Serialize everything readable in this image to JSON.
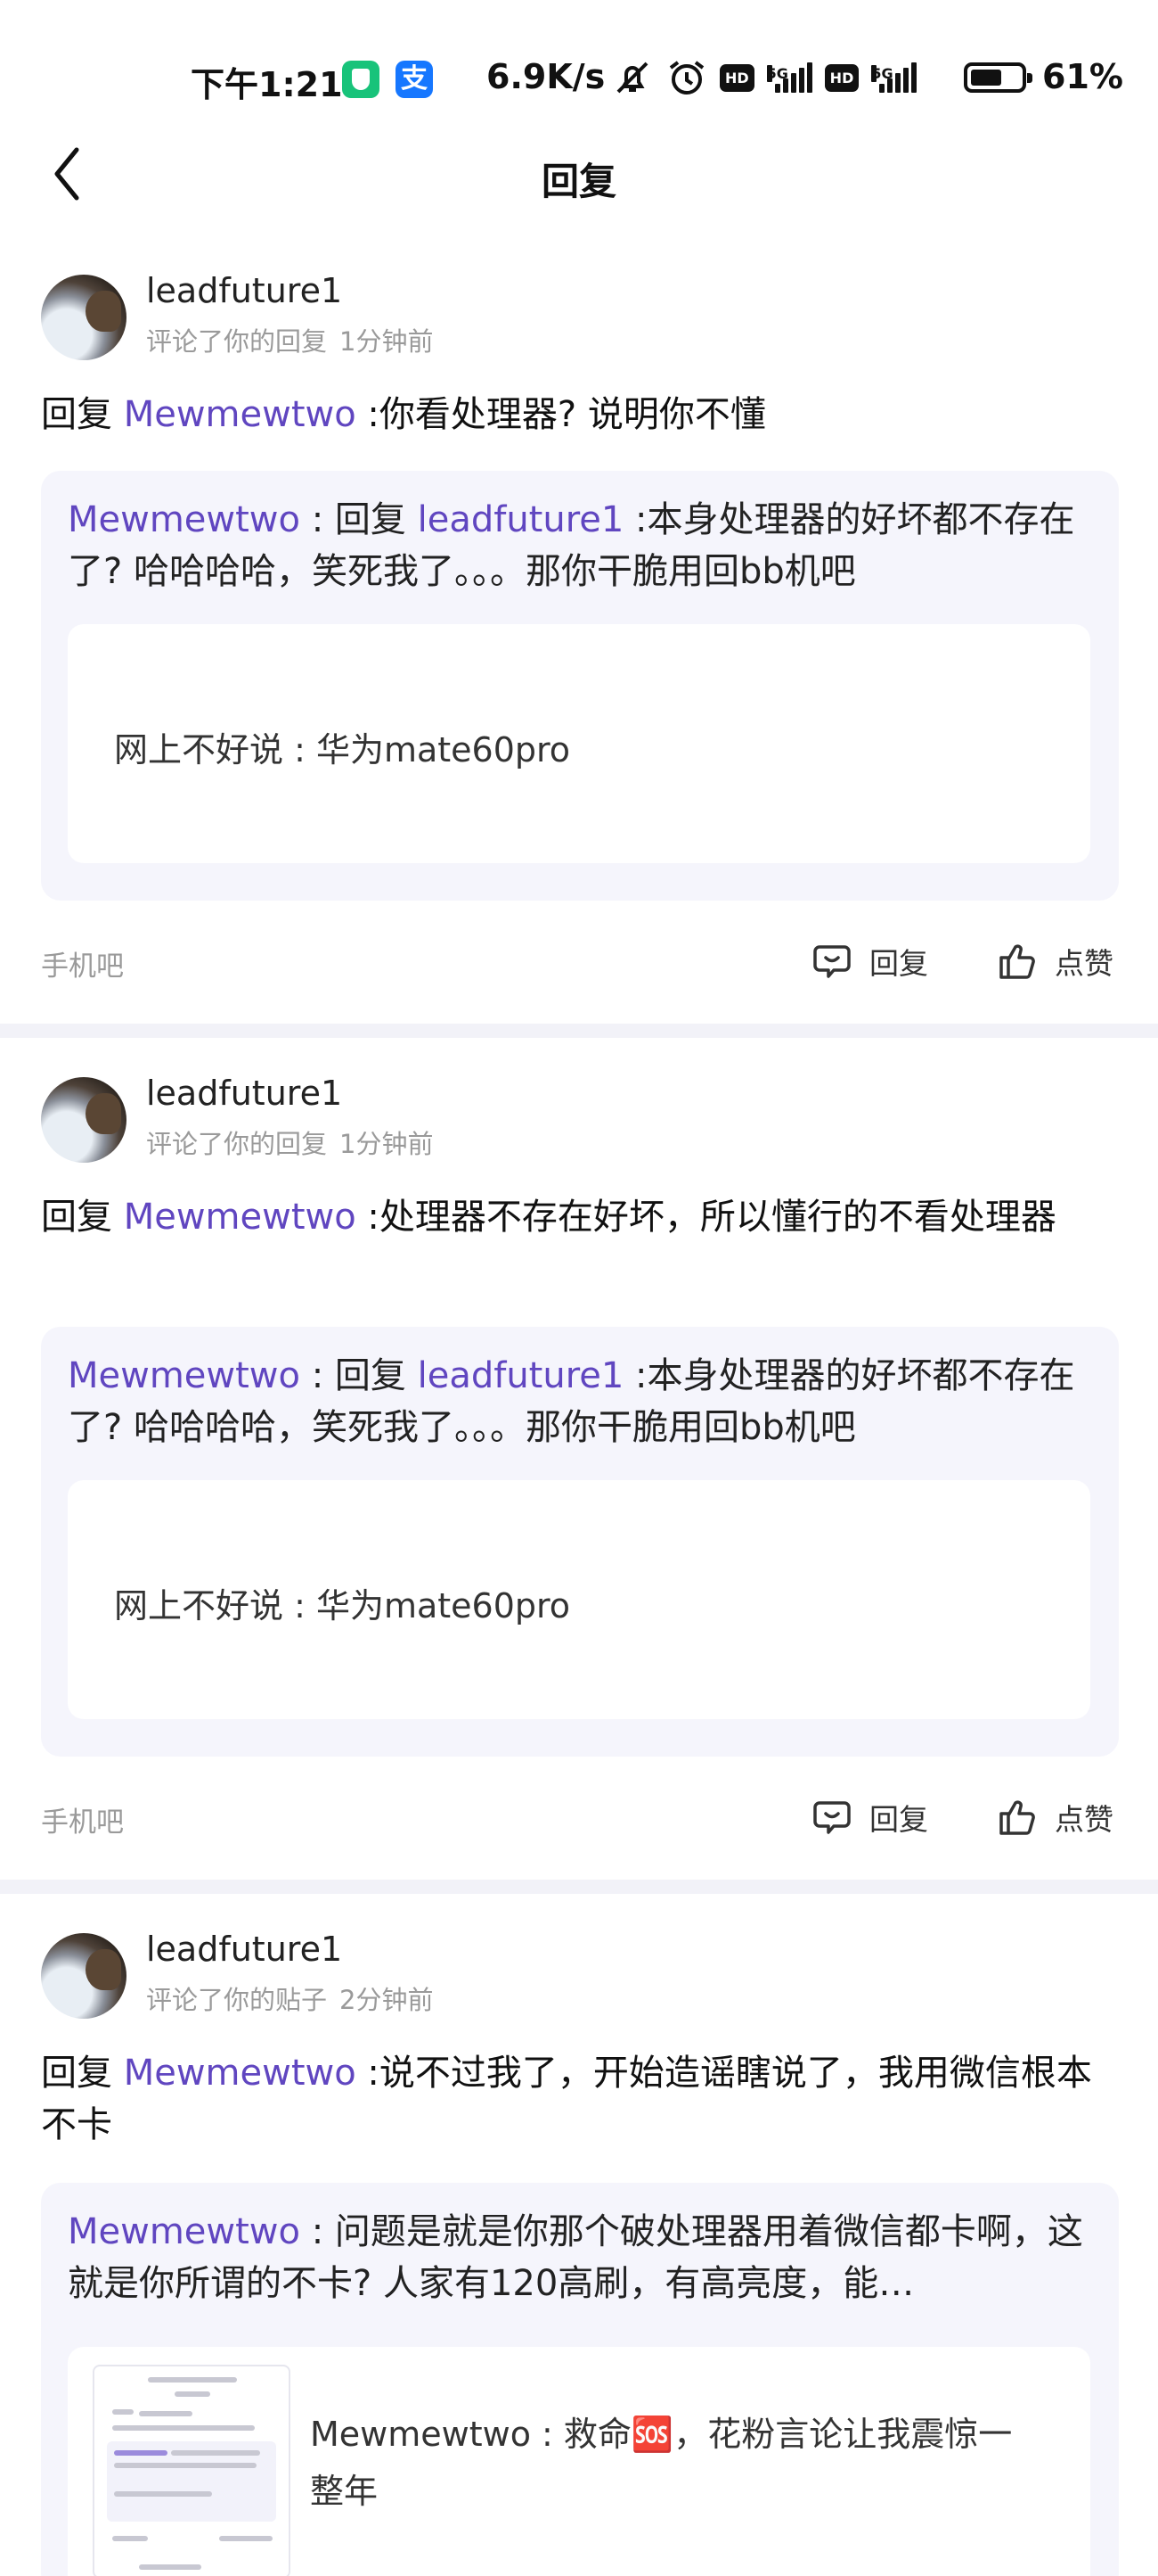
{
  "status_bar": {
    "time": "下午1:21",
    "net_speed": "6.9K/s",
    "battery_text": "61%",
    "icons": [
      "shield-app-icon",
      "alipay-icon",
      "mute-icon",
      "alarm-icon",
      "hd-icon",
      "5g-signal-icon",
      "hd-icon",
      "5g-signal-icon",
      "battery-icon"
    ],
    "hd_label": "HD",
    "fiveg_label": "5G",
    "alipay_glyph": "支"
  },
  "header": {
    "title": "回复",
    "back_icon": "chevron-left-icon"
  },
  "colors": {
    "highlight": "#6046c0",
    "quote_bg": "#f5f5fc",
    "meta": "#9a9a9a",
    "divider": "#f2f2f8"
  },
  "items": [
    {
      "user": "leadfuture1",
      "action": "评论了你的回复",
      "time": "1分钟前",
      "comment_prefix": "回复",
      "comment_target": "Mewmewtwo",
      "comment_text": " :你看处理器? 说明你不懂",
      "quote_author": "Mewmewtwo",
      "quote_sep": " : 回复 ",
      "quote_target": "leadfuture1",
      "quote_text": " :本身处理器的好坏都不存在了? 哈哈哈哈，笑死我了。。。那你干脆用回bb机吧",
      "inner_text": "网上不好说 : 华为mate60pro",
      "forum": "手机吧",
      "reply_label": "回复",
      "like_label": "点赞"
    },
    {
      "user": "leadfuture1",
      "action": "评论了你的回复",
      "time": "1分钟前",
      "comment_prefix": "回复",
      "comment_target": "Mewmewtwo",
      "comment_text": " :处理器不存在好坏，所以懂行的不看处理器",
      "quote_author": "Mewmewtwo",
      "quote_sep": " : 回复 ",
      "quote_target": "leadfuture1",
      "quote_text": " :本身处理器的好坏都不存在了? 哈哈哈哈，笑死我了。。。那你干脆用回bb机吧",
      "inner_text": "网上不好说 : 华为mate60pro",
      "forum": "手机吧",
      "reply_label": "回复",
      "like_label": "点赞"
    },
    {
      "user": "leadfuture1",
      "action": "评论了你的贴子",
      "time": "2分钟前",
      "comment_prefix": "回复",
      "comment_target": "Mewmewtwo",
      "comment_text": " :说不过我了，开始造谣瞎说了，我用微信根本不卡",
      "quote_author": "Mewmewtwo",
      "quote_sep": " : ",
      "quote_text": "问题是就是你那个破处理器用着微信都卡啊，这就是你所谓的不卡? 人家有120高刷，有高亮度，能…",
      "inner_text": "Mewmewtwo : 救命🆘，花粉言论让我震惊一整年"
    }
  ]
}
